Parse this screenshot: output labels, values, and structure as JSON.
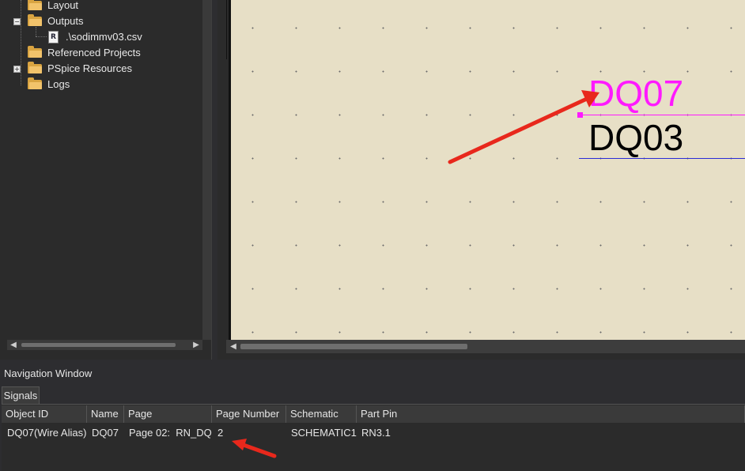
{
  "project_tree": {
    "items": [
      {
        "label": "Layout",
        "icon": "folder-icon"
      },
      {
        "label": "Outputs",
        "icon": "folder-icon",
        "expander": "−"
      },
      {
        "label": ".\\sodimmv03.csv",
        "icon": "report-file-icon",
        "icon_glyph": "R"
      },
      {
        "label": "Referenced Projects",
        "icon": "folder-icon"
      },
      {
        "label": "PSpice Resources",
        "icon": "folder-icon",
        "expander": "+"
      },
      {
        "label": "Logs",
        "icon": "folder-icon"
      }
    ],
    "scroll_left": "◀",
    "scroll_right": "▶"
  },
  "schematic": {
    "net_labels": [
      {
        "text": "DQ07",
        "color": "#ff19ff",
        "wire_color": "#ff19ff"
      },
      {
        "text": "DQ03",
        "color": "#000000",
        "wire_color": "#2b2bd6"
      }
    ],
    "annotation_arrow_color": "#e8281c",
    "scroll_left": "◀"
  },
  "navigation_window": {
    "title": "Navigation Window",
    "tabs": [
      "Signals"
    ],
    "columns": [
      "Object ID",
      "Name",
      "Page",
      "Page Number",
      "Schematic",
      "Part Pin"
    ],
    "rows": [
      [
        "DQ07(Wire Alias)",
        "DQ07",
        "Page 02:  RN_DQ",
        "2",
        "SCHEMATIC1",
        "RN3.1"
      ]
    ]
  }
}
